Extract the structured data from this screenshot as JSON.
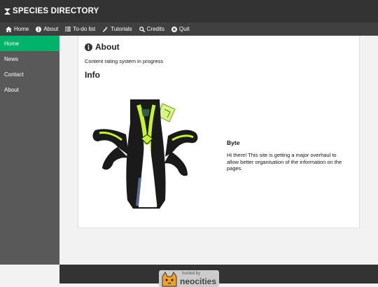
{
  "header": {
    "title": "SPECIES DIRECTORY"
  },
  "nav": {
    "items": [
      {
        "label": "Home",
        "icon": "home-icon"
      },
      {
        "label": "About",
        "icon": "info-icon"
      },
      {
        "label": "To-do list",
        "icon": "list-icon"
      },
      {
        "label": "Tutorials",
        "icon": "wand-icon"
      },
      {
        "label": "Credits",
        "icon": "search-icon"
      },
      {
        "label": "Quit",
        "icon": "close-circle-icon"
      }
    ]
  },
  "sidebar": {
    "items": [
      {
        "label": "Home",
        "active": true
      },
      {
        "label": "News"
      },
      {
        "label": "Contact"
      },
      {
        "label": "About"
      }
    ]
  },
  "main": {
    "about_heading": "About",
    "about_text": "Content rating system in progress",
    "info_heading": "Info",
    "character_name": "Byte",
    "character_text": "Hi there! This site is getting a major overhaul to allow better organisation of the information on the pages."
  },
  "footer": {
    "badge_small": "hosted by",
    "badge_big": "neocities"
  },
  "colors": {
    "accent": "#00b36b",
    "topbar": "#333333",
    "navbar": "#404040",
    "sidebar": "#595959"
  }
}
